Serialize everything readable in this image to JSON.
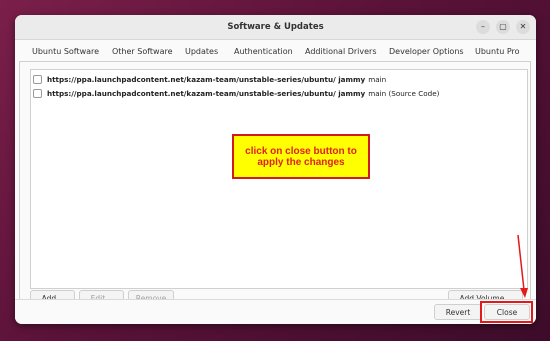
{
  "window": {
    "title": "Software & Updates",
    "controls": {
      "minimize": "–",
      "maximize": "▢",
      "close": "✕"
    }
  },
  "tabs": [
    {
      "label": "Ubuntu Software",
      "active": false
    },
    {
      "label": "Other Software",
      "active": true
    },
    {
      "label": "Updates",
      "active": false
    },
    {
      "label": "Authentication",
      "active": false
    },
    {
      "label": "Additional Drivers",
      "active": false
    },
    {
      "label": "Developer Options",
      "active": false
    },
    {
      "label": "Ubuntu Pro",
      "active": false
    }
  ],
  "sources": [
    {
      "checked": false,
      "url": "https://ppa.launchpadcontent.net/kazam-team/unstable-series/ubuntu/ jammy",
      "suffix": "main"
    },
    {
      "checked": false,
      "url": "https://ppa.launchpadcontent.net/kazam-team/unstable-series/ubuntu/ jammy",
      "suffix": "main (Source Code)"
    }
  ],
  "list_buttons": {
    "add": "Add...",
    "edit": "Edit...",
    "remove": "Remove",
    "add_volume": "Add Volume..."
  },
  "footer_buttons": {
    "revert": "Revert",
    "close": "Close"
  },
  "annotation": {
    "callout_text": "click on close button to apply the changes",
    "accent_color": "#e21a1a",
    "callout_bg": "#ffff00"
  },
  "colors": {
    "tab_underline": "#e95420"
  }
}
